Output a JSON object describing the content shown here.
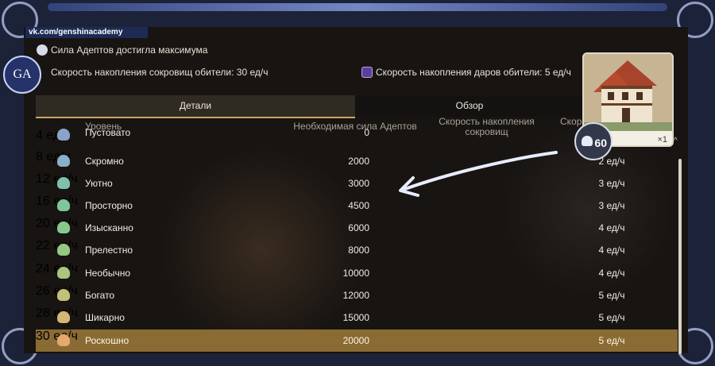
{
  "watermark": "vk.com/genshinacademy",
  "logo_text": "GA",
  "status": {
    "adepts_max": "Сила Адептов достигла максимума",
    "treasure_rate": "Скорость накопления сокровищ обители: 30 ед/ч",
    "gift_rate": "Скорость накопления даров обители: 5 ед/ч"
  },
  "tabs": [
    {
      "label": "Детали",
      "active": true
    },
    {
      "label": "Обзор",
      "active": false
    }
  ],
  "columns": {
    "level": "Уровень",
    "power": "Необходимая сила Адептов",
    "treasure": "Скорость накопления сокровищ",
    "gift": "Скор"
  },
  "rows": [
    {
      "name": "Пустовато",
      "power": "0",
      "treasure": "4 ед/ч",
      "gift": "",
      "icon_color": "#8aa3c8"
    },
    {
      "name": "Скромно",
      "power": "2000",
      "treasure": "8 ед/ч",
      "gift": "2 ед/ч",
      "icon_color": "#8ab0c8"
    },
    {
      "name": "Уютно",
      "power": "3000",
      "treasure": "12 ед/ч",
      "gift": "3 ед/ч",
      "icon_color": "#7fbfae"
    },
    {
      "name": "Просторно",
      "power": "4500",
      "treasure": "16 ед/ч",
      "gift": "3 ед/ч",
      "icon_color": "#7ec59c"
    },
    {
      "name": "Изысканно",
      "power": "6000",
      "treasure": "20 ед/ч",
      "gift": "4 ед/ч",
      "icon_color": "#86c98e"
    },
    {
      "name": "Прелестно",
      "power": "8000",
      "treasure": "22 ед/ч",
      "gift": "4 ед/ч",
      "icon_color": "#96c884"
    },
    {
      "name": "Необычно",
      "power": "10000",
      "treasure": "24 ед/ч",
      "gift": "4 ед/ч",
      "icon_color": "#a8c67e"
    },
    {
      "name": "Богато",
      "power": "12000",
      "treasure": "26 ед/ч",
      "gift": "5 ед/ч",
      "icon_color": "#c3c07a"
    },
    {
      "name": "Шикарно",
      "power": "15000",
      "treasure": "28 ед/ч",
      "gift": "5 ед/ч",
      "icon_color": "#d4b676"
    },
    {
      "name": "Роскошно",
      "power": "20000",
      "treasure": "30 ед/ч",
      "gift": "5 ед/ч",
      "icon_color": "#e3a96e",
      "selected": true
    }
  ],
  "item_card": {
    "quantity": "×1",
    "badge_value": "60"
  },
  "colors": {
    "accent": "#c9a862",
    "selected_row": "#8a6b34",
    "panel_bg": "#171412",
    "frame": "#1c2238"
  }
}
